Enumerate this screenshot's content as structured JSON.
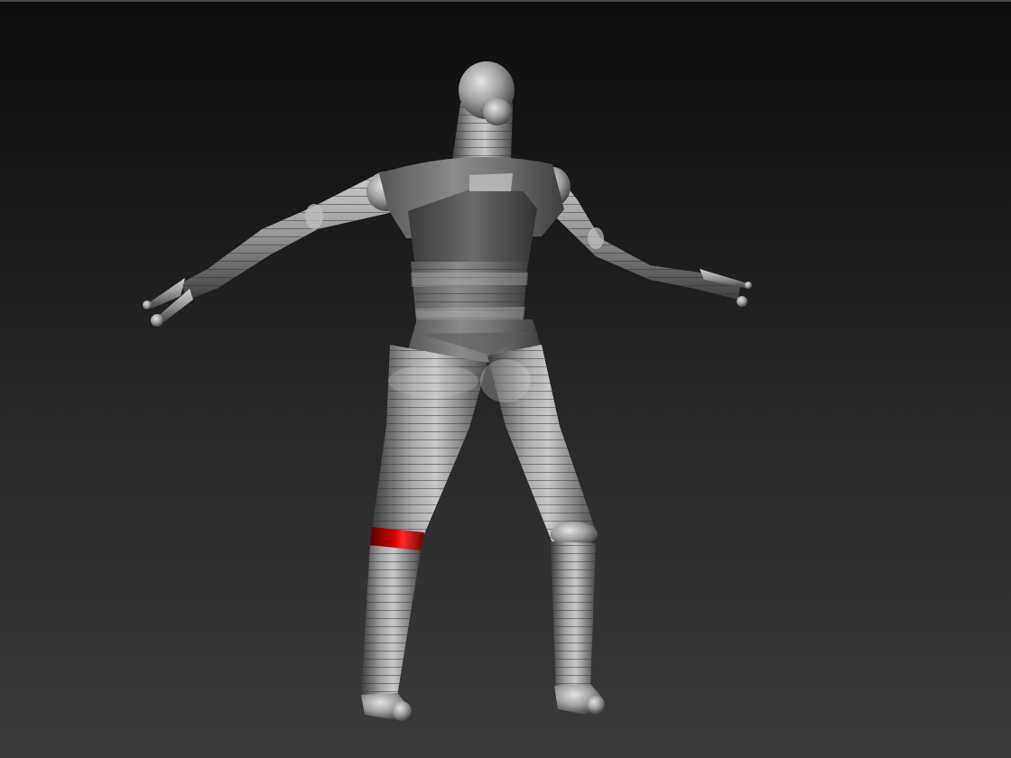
{
  "viewport": {
    "background_top": "#0e0e0e",
    "background_bottom": "#3b3b3b"
  },
  "model": {
    "base_color": "#9a9a9a",
    "highlight_color": "#e6e6e6",
    "shadow_color": "#3a3a3a",
    "selected_segment_color": "#c00000",
    "selected_segment": "left-knee-ring",
    "ring_style": "banded"
  }
}
